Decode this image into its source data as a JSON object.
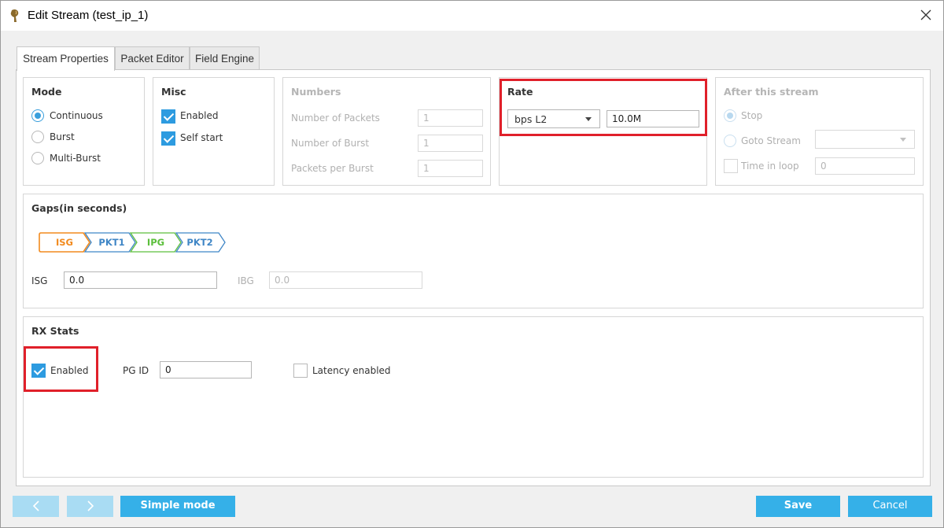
{
  "window": {
    "title": "Edit Stream (test_ip_1)"
  },
  "tabs": [
    {
      "label": "Stream Properties",
      "active": true
    },
    {
      "label": "Packet Editor",
      "active": false
    },
    {
      "label": "Field Engine",
      "active": false
    }
  ],
  "mode": {
    "title": "Mode",
    "options": [
      {
        "label": "Continuous",
        "selected": true
      },
      {
        "label": "Burst",
        "selected": false
      },
      {
        "label": "Multi-Burst",
        "selected": false
      }
    ]
  },
  "misc": {
    "title": "Misc",
    "enabled_label": "Enabled",
    "self_start_label": "Self start"
  },
  "numbers": {
    "title": "Numbers",
    "num_packets_label": "Number of Packets",
    "num_packets_value": "1",
    "num_burst_label": "Number of Burst",
    "num_burst_value": "1",
    "packets_per_burst_label": "Packets per Burst",
    "packets_per_burst_value": "1"
  },
  "rate": {
    "title": "Rate",
    "unit": "bps L2",
    "value": "10.0M"
  },
  "after": {
    "title": "After this stream",
    "stop_label": "Stop",
    "goto_label": "Goto Stream",
    "goto_value": "",
    "loop_label": "Time in loop",
    "loop_value": "0"
  },
  "gaps": {
    "title": "Gaps(in seconds)",
    "chevrons": [
      "ISG",
      "PKT1",
      "IPG",
      "PKT2"
    ],
    "isg_label": "ISG",
    "isg_value": "0.0",
    "ibg_label": "IBG",
    "ibg_value": "0.0"
  },
  "rx": {
    "title": "RX Stats",
    "enabled_label": "Enabled",
    "pgid_label": "PG ID",
    "pgid_value": "0",
    "latency_label": "Latency enabled"
  },
  "footer": {
    "prev_icon": "chevron-left-icon",
    "next_icon": "chevron-right-icon",
    "simple_mode_label": "Simple mode",
    "save_label": "Save",
    "cancel_label": "Cancel"
  },
  "colors": {
    "accent": "#35b0e8",
    "highlight": "#e0202a",
    "isg": "#f28a1e",
    "pkt": "#3f86c6",
    "ipg": "#5cbf3c"
  }
}
